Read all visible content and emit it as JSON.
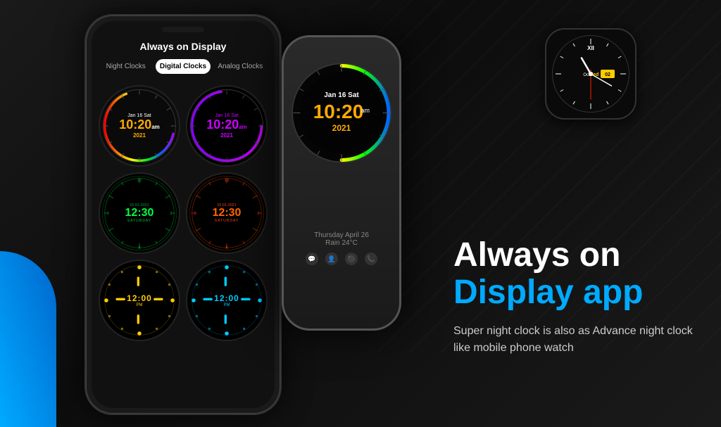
{
  "app": {
    "title": "Always on Display app",
    "headline_line1": "Always on",
    "headline_line2": "Display app",
    "subtext": "Super night clock is also as Advance night clock like mobile phone watch"
  },
  "phone": {
    "header": "Always on Display",
    "tabs": [
      {
        "label": "Night Clocks",
        "active": false
      },
      {
        "label": "Digital Clocks",
        "active": true
      },
      {
        "label": "Analog Clocks",
        "active": false
      }
    ]
  },
  "clocks": [
    {
      "id": "clock1",
      "type": "rainbow-digital",
      "date": "Jan 16 Sat",
      "time": "10:20",
      "ampm": "am",
      "year": "2021"
    },
    {
      "id": "clock2",
      "type": "purple-digital",
      "date": "Jan 16 Sat",
      "time": "10:20",
      "ampm": "am",
      "year": "2021"
    },
    {
      "id": "clock3",
      "type": "green-digital",
      "date": "15.01.2021",
      "time": "12:30",
      "day": "SATURDAY"
    },
    {
      "id": "clock4",
      "type": "orange-digital",
      "date": "15.01.2021",
      "time": "12:30",
      "day": "SATURDAY"
    },
    {
      "id": "clock5",
      "type": "yellow-dots",
      "time": "12:00",
      "ampm": "PM"
    },
    {
      "id": "clock6",
      "type": "cyan-dots",
      "time": "12:00",
      "ampm": "PM"
    }
  ],
  "big_clock": {
    "date": "Jan 16 Sat",
    "time": "10:20",
    "ampm": "am",
    "year": "2021",
    "weather": "Thursday April 26",
    "condition": "Rain 24°C"
  },
  "watch": {
    "day": "Wed",
    "month": "Oct",
    "date": "02"
  },
  "colors": {
    "bg": "#0a0a0a",
    "accent_blue": "#00aaff",
    "accent_yellow": "#ffcc00",
    "rainbow_1": "#ff0000",
    "green": "#00ff44",
    "orange": "#ff6600",
    "purple": "#cc00ff",
    "cyan": "#00ccff"
  }
}
